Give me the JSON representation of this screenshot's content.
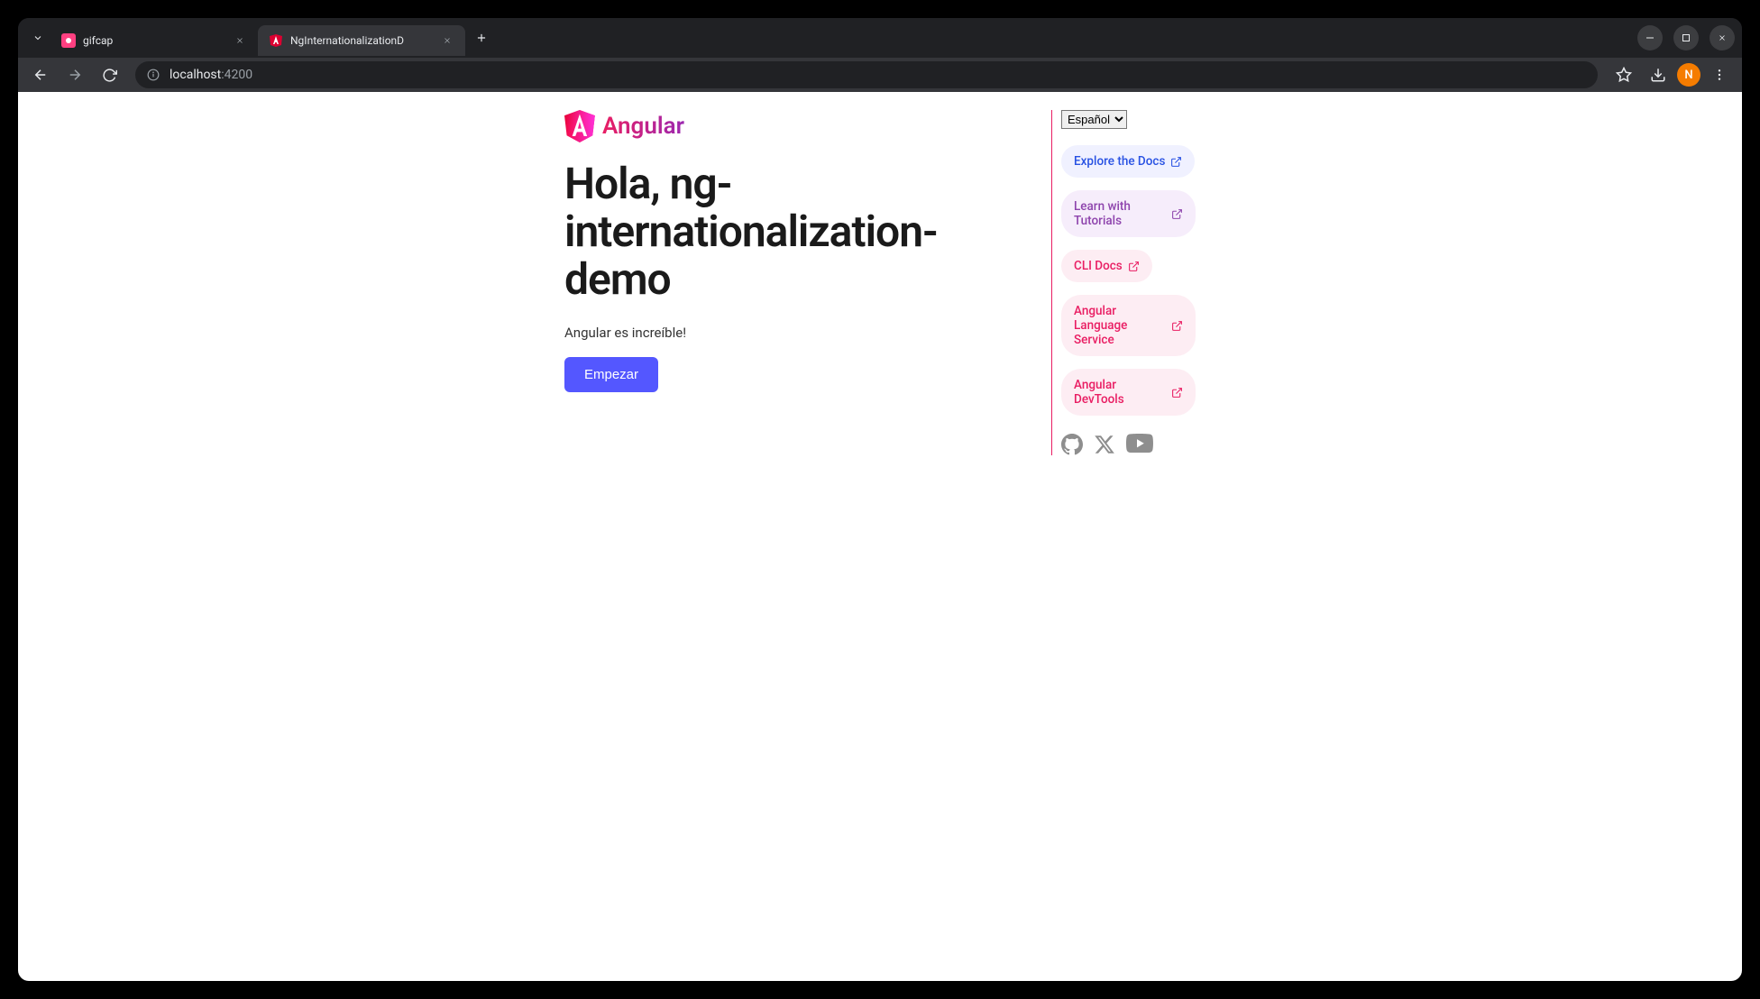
{
  "browser": {
    "tabs": [
      {
        "title": "gifcap",
        "active": false
      },
      {
        "title": "NgInternationalizationD",
        "active": true
      }
    ],
    "url_host": "localhost",
    "url_port": ":4200",
    "avatar_letter": "N"
  },
  "page": {
    "logo_text": "Angular",
    "heading": "Hola, ng-internationalization-demo",
    "subtitle": "Angular es increíble!",
    "cta": "Empezar",
    "language_selected": "Español",
    "pills": [
      {
        "label": "Explore the Docs",
        "variant": "blue"
      },
      {
        "label": "Learn with Tutorials",
        "variant": "purple"
      },
      {
        "label": "CLI Docs",
        "variant": "pink"
      },
      {
        "label": "Angular Language Service",
        "variant": "pink"
      },
      {
        "label": "Angular DevTools",
        "variant": "pink"
      }
    ]
  }
}
